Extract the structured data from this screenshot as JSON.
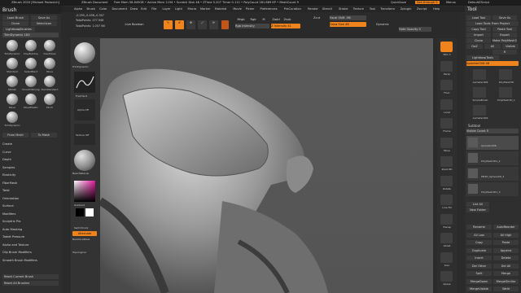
{
  "titlebar": {
    "app": "ZBrush 2020 [Michael Pavlovich]",
    "doc": "ZBrush Document",
    "stats": "Free Mem 56.645GB • Active Mem 1194 • Scratch Disk 48 • ZTime 5.207 Timer 0.112 • PolyCount 281.869 KP • MeshCount 9",
    "quicksave": "QuickSave",
    "seethrough": "See-through 0",
    "menus": "Menus",
    "defaultzscript": "DefaultZScript"
  },
  "menubar": [
    "Alpha",
    "Brush",
    "Color",
    "Document",
    "Draw",
    "Edit",
    "File",
    "Layer",
    "Light",
    "Macro",
    "Marker",
    "Material",
    "Movie",
    "Picker",
    "Preferences",
    "PreCuration",
    "Render",
    "Stencil",
    "Stroke",
    "Texture",
    "Tool",
    "Transform",
    "Zplugin",
    "Zscript",
    "Help"
  ],
  "brush": {
    "title": "Brush",
    "buttons": [
      "Load Brush",
      "Save As",
      "Clone",
      "SelectIcon",
      "Lightbox▸Brushes"
    ],
    "trim": "TrimDynamic  183",
    "coords": "-0.295,-0.456,-0.307",
    "items": [
      "TrimDynamic",
      "ClayBuildup",
      "ClayTubes",
      "Standard",
      "SelectRect",
      "Move",
      "hPolish",
      "SmoothStronger",
      "DamStandard",
      "Move",
      "MoveElastic",
      "Pinch",
      "TrimDynamic"
    ],
    "from_mesh": "From Mesh",
    "to_mesh": "To Mesh",
    "submenus": [
      "Create",
      "Curve",
      "Depth",
      "Samples",
      "Elasticity",
      "FiberMesh",
      "Twist",
      "Orientation",
      "Surface",
      "Modifiers",
      "Sculptris Pro",
      "Auto Masking",
      "Tablet Pressure",
      "Alpha and Texture",
      "Clip Brush Modifiers",
      "Smooth Brush Modifiers"
    ],
    "reset": "Reset Current Brush",
    "reset_all": "Reset All Brushes"
  },
  "toptool": {
    "polys": "TotalPoints: 277.946",
    "total": "TotalPoints: 1.057 Mil",
    "live_boolean": "Live Boolean",
    "edit": "Edit",
    "draw": "Draw",
    "move": "Move",
    "scale": "Scale",
    "rotate": "Rotate",
    "mrgb": "Mrgb",
    "rgb": "Rgb",
    "m": "M",
    "zadd": "Zadd",
    "zsub": "Zsub",
    "zcut": "Zcut",
    "rgb_intensity": "Rgb Intensity",
    "z_intensity": "Z Intensity 41",
    "focal_shift": "Focal Shift -96",
    "draw_size": "Draw Size 48",
    "dynamic": "Dynamic",
    "fade_opacity": "Fade Opacity 0"
  },
  "shelf": {
    "brush1": "TrimDynamic",
    "stroke": "FreeHand",
    "alpha": "Alpha Off",
    "texture": "Texture Off",
    "material": "BasicMaterial",
    "gradient": "Gradient",
    "switch_color": "SwitchColor",
    "alternate": "Alternate",
    "backface": "BackfaceMask",
    "topological": "Topological"
  },
  "nav": [
    "SPix 3",
    "Persp",
    "Floor",
    "Local",
    "Frame",
    "Move",
    "Zoom3D",
    "Rotate",
    "Line Fill",
    "Transp",
    "Ghost",
    "Solo",
    "Xpose"
  ],
  "tool": {
    "title": "Tool",
    "buttons": [
      "Load Tool",
      "Save As",
      "Load Tools From Project",
      "Copy Tool",
      "Paste Tool",
      "Import",
      "Export",
      "Clone",
      "Make PolyMesh3D",
      "GoZ",
      "All",
      "Visible",
      "R",
      "Lightbox▸Tools"
    ],
    "current": "Apmeter006  48",
    "thumbs": [
      "Apmeter006",
      "PolyMesh3D",
      "SimpleBrush",
      "PolyMesh3D_1",
      "Apmeter006"
    ],
    "subtool": "Subtool",
    "visible_count": "Visible Count 5",
    "subtools": [
      "Apmeter006",
      "PolyMesh3D1_2",
      "PM3D_Sphere3D_3",
      "PolyMesh3D1_3"
    ],
    "list_all": "List All",
    "new_folder": "New Folder",
    "ops": [
      "Rename",
      "AutoReorder",
      "All Low",
      "All High",
      "Copy",
      "Paste",
      "Duplicate",
      "Append",
      "Insert",
      "Delete",
      "Del Other",
      "Del All",
      "Split",
      "Merge",
      "MergeDown",
      "MergeSimilar",
      "MergeVisible",
      "Weld"
    ]
  },
  "colors": {
    "accent": "#f0841c",
    "canvas": "#575757",
    "panel": "#2f2f2f"
  }
}
